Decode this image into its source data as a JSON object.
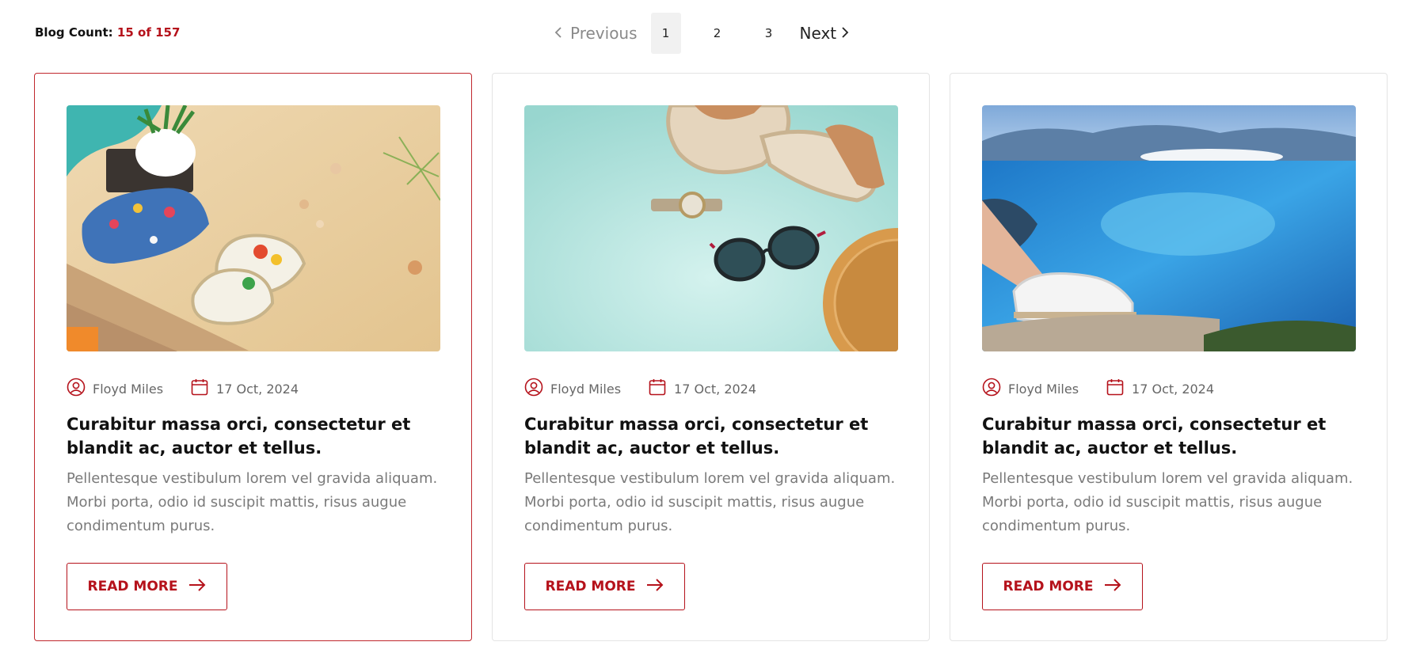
{
  "blog_count": {
    "label": "Blog Count:",
    "value": "15 of 157"
  },
  "pagination": {
    "previous": "Previous",
    "next": "Next",
    "pages": [
      "1",
      "2",
      "3"
    ],
    "active_page": "1"
  },
  "posts": [
    {
      "image": "espadrilles on beach sand",
      "author": "Floyd Miles",
      "date": "17 Oct, 2024",
      "title": "Curabitur massa orci, consectetur et blandit ac, auctor et tellus.",
      "excerpt": "Pellentesque vestibulum lorem vel gravida aliquam. Morbi porta, odio id suscipit mattis, risus augue condimentum purus.",
      "cta": "READ MORE"
    },
    {
      "image": "sandals, watch, sunglasses on mint background",
      "author": "Floyd Miles",
      "date": "17 Oct, 2024",
      "title": "Curabitur massa orci, consectetur et blandit ac, auctor et tellus.",
      "excerpt": "Pellentesque vestibulum lorem vel gravida aliquam. Morbi porta, odio id suscipit mattis, risus augue condimentum purus.",
      "cta": "READ MORE"
    },
    {
      "image": "white sneaker over blue sea",
      "author": "Floyd Miles",
      "date": "17 Oct, 2024",
      "title": "Curabitur massa orci, consectetur et blandit ac, auctor et tellus.",
      "excerpt": "Pellentesque vestibulum lorem vel gravida aliquam. Morbi porta, odio id suscipit mattis, risus augue condimentum purus.",
      "cta": "READ MORE"
    }
  ],
  "colors": {
    "accent": "#b5121b",
    "border": "#e4e4e4",
    "muted_text": "#7a7a7a"
  },
  "icons": {
    "author": "user-circle-icon",
    "date": "calendar-icon",
    "cta": "arrow-right-icon",
    "prev": "chevron-left-icon",
    "next": "chevron-right-icon"
  }
}
